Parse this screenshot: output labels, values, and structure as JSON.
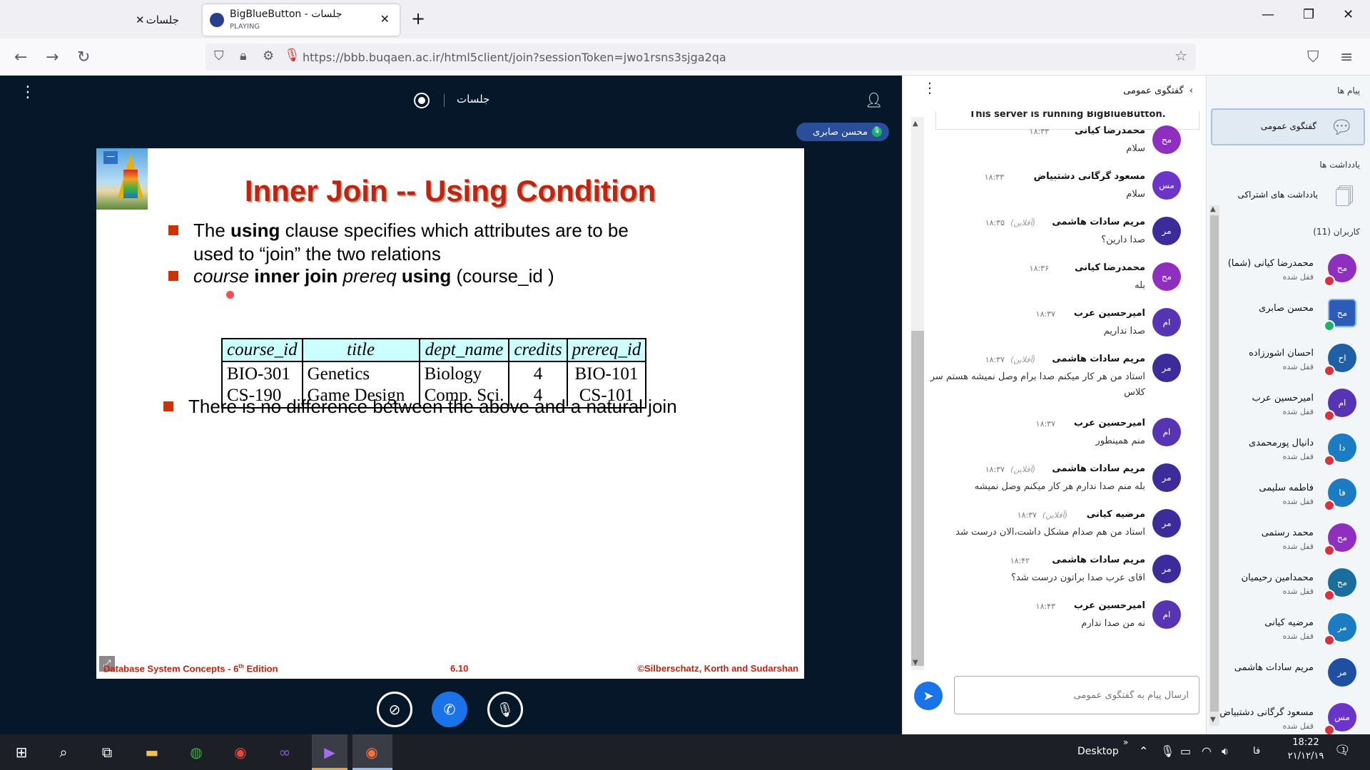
{
  "browser": {
    "inactive_tab": "جلسات",
    "active_tab_title": "BigBlueButton - جلسات",
    "active_tab_status": "PLAYING",
    "url": "https://bbb.buqaen.ac.ir/html5client/join?sessionToken=jwo1rsns3sjga2qa"
  },
  "meeting": {
    "title": "جلسات",
    "presenter_badge": "محسن صابری"
  },
  "slide": {
    "title": "Inner Join -- Using Condition",
    "bullet1_line1_pre": "The ",
    "bullet1_line1_bold": "using",
    "bullet1_line1_post": " clause specifies which attributes are to be",
    "bullet1_line2": "used to “join” the two relations",
    "bullet2_a": "course",
    "bullet2_b": " inner join ",
    "bullet2_c": "prereq",
    "bullet2_d": " using ",
    "bullet2_e": "(course_id )",
    "bullet3": "There is no difference between the above and a natural join",
    "table_headers": [
      "course_id",
      "title",
      "dept_name",
      "credits",
      "prereq_id"
    ],
    "table_rows": [
      [
        "BIO-301",
        "Genetics",
        "Biology",
        "4",
        "BIO-101"
      ],
      [
        "CS-190",
        "Game Design",
        "Comp. Sci.",
        "4",
        "CS-101"
      ]
    ],
    "footer_left": "Database System Concepts - 6",
    "footer_left_sup": "th",
    "footer_left_end": " Edition",
    "footer_center": "6.10",
    "footer_right": "©Silberschatz, Korth and Sudarshan"
  },
  "chat": {
    "header": "گفتگوی عمومی",
    "banner": "This server is running BigBlueButton.",
    "input_placeholder": "ارسال پیام به گفتگوی عمومی",
    "messages": [
      {
        "avatar": "مح",
        "name": "محمدرضا کیانی",
        "time": "۱۸:۳۳",
        "status": "",
        "text": "سلام",
        "color": "#8e2fc0"
      },
      {
        "avatar": "مس",
        "name": "مسعود گرگانی دشتبیاض",
        "time": "۱۸:۳۳",
        "status": "",
        "text": "سلام",
        "color": "#6a35c8"
      },
      {
        "avatar": "مر",
        "name": "مریم سادات هاشمی",
        "time": "۱۸:۳۵",
        "status": "(آفلاین)",
        "text": "صدا دارین؟",
        "color": "#3c2b9a"
      },
      {
        "avatar": "مح",
        "name": "محمدرضا کیانی",
        "time": "۱۸:۳۶",
        "status": "",
        "text": "بله",
        "color": "#8e2fc0"
      },
      {
        "avatar": "ام",
        "name": "امیرحسین عرب",
        "time": "۱۸:۳۷",
        "status": "",
        "text": "صدا نداریم",
        "color": "#5634b4"
      },
      {
        "avatar": "مر",
        "name": "مریم سادات هاشمی",
        "time": "۱۸:۳۷",
        "status": "(آفلاین)",
        "text": "استاد من هر کار میکنم صدا برام وصل نمیشه هستم سر کلاس",
        "color": "#3c2b9a"
      },
      {
        "avatar": "ام",
        "name": "امیرحسین عرب",
        "time": "۱۸:۳۷",
        "status": "",
        "text": "منم همینطور",
        "color": "#5634b4"
      },
      {
        "avatar": "مر",
        "name": "مریم سادات هاشمی",
        "time": "۱۸:۳۷",
        "status": "(آفلاین)",
        "text": "بله منم صدا ندارم هر کار میکنم وصل نمیشه",
        "color": "#3c2b9a"
      },
      {
        "avatar": "مر",
        "name": "مرضیه کیانی",
        "time": "۱۸:۳۷",
        "status": "(آفلاین)",
        "text": "استاد من هم صدام مشکل داشت،الان درست شد",
        "color": "#3c2b9a"
      },
      {
        "avatar": "مر",
        "name": "مریم سادات هاشمی",
        "time": "۱۸:۴۲",
        "status": "",
        "text": "اقای عرب صدا براتون درست شد؟",
        "color": "#3c2b9a"
      },
      {
        "avatar": "ام",
        "name": "امیرحسین عرب",
        "time": "۱۸:۴۳",
        "status": "",
        "text": "نه من صدا ندارم",
        "color": "#5634b4"
      }
    ]
  },
  "sidebar": {
    "messages_title": "پیام ها",
    "public_chat": "گفتگوی عمومی",
    "notes_title": "یادداشت ها",
    "shared_notes": "یادداشت های اشتراکی",
    "users_title": "کاربران (11)",
    "locked_label": "قفل شده",
    "users": [
      {
        "avatar": "مح",
        "name": "محمدرضا کیانی (شما)",
        "locked": true,
        "color": "#8e2fc0"
      },
      {
        "avatar": "مح",
        "name": "محسن صابری",
        "locked": false,
        "color": "#2d5bb8"
      },
      {
        "avatar": "اح",
        "name": "احسان اشورزاده",
        "locked": true,
        "color": "#1f5fa8"
      },
      {
        "avatar": "ام",
        "name": "امیرحسین عرب",
        "locked": true,
        "color": "#5634b4"
      },
      {
        "avatar": "دا",
        "name": "دانیال پورمحمدی",
        "locked": true,
        "color": "#1b7cc4"
      },
      {
        "avatar": "فا",
        "name": "فاطمه سلیمی",
        "locked": true,
        "color": "#1b7cc4"
      },
      {
        "avatar": "مح",
        "name": "محمد رستمی",
        "locked": true,
        "color": "#8e2fc0"
      },
      {
        "avatar": "مح",
        "name": "محمدامین رحیمیان",
        "locked": true,
        "color": "#1b6d9c"
      },
      {
        "avatar": "مر",
        "name": "مرضیه کیانی",
        "locked": true,
        "color": "#1b7cc4"
      },
      {
        "avatar": "مر",
        "name": "مریم سادات هاشمی",
        "locked": false,
        "color": "#1f4fa0"
      },
      {
        "avatar": "مس",
        "name": "مسعود گرگانی دشتبیاض",
        "locked": true,
        "color": "#6a35c8"
      }
    ]
  },
  "taskbar": {
    "desktop_label": "Desktop",
    "lang": "فا",
    "time": "18:22",
    "date": "۲۱/۱۲/۱۹",
    "notif_count": "1"
  }
}
